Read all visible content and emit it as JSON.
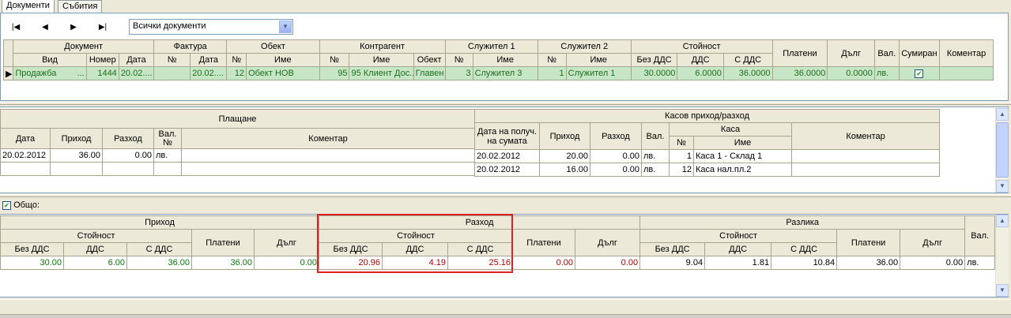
{
  "tabs": [
    "Документи",
    "Събития"
  ],
  "nav": {
    "first": "|◀",
    "prev": "◀",
    "next": "▶",
    "last": "▶|"
  },
  "filter": {
    "selected": "Всички документи"
  },
  "docs": {
    "groups": {
      "document": "Документ",
      "invoice": "Фактура",
      "object": "Обект",
      "partner": "Контрагент",
      "emp1": "Служител 1",
      "emp2": "Служител 2",
      "value": "Стойност"
    },
    "cols": {
      "type": "Вид",
      "number": "Номер",
      "date": "Дата",
      "inv_no": "№",
      "inv_date": "Дата",
      "obj_no": "№",
      "obj_name": "Име",
      "partner_no": "№",
      "partner_name": "Име",
      "partner_obj": "Обект",
      "emp1_no": "№",
      "emp1_name": "Име",
      "emp2_no": "№",
      "emp2_name": "Име",
      "no_vat": "Без ДДС",
      "vat": "ДДС",
      "with_vat": "С ДДС",
      "paid": "Платени",
      "debt": "Дълг",
      "cur": "Вал.",
      "summed": "Сумиран",
      "comment": "Коментар"
    },
    "row": {
      "type": "Продажба",
      "dots": "...",
      "number": "1444",
      "date": "20.02....",
      "inv_date": "20.02....",
      "obj_no": "12",
      "obj_name": "Обект НОВ",
      "partner_no": "95",
      "partner_name": "95 Клиент Дос...",
      "partner_obj": "Главен",
      "emp1_no": "3",
      "emp1_name": "Служител 3",
      "emp2_no": "1",
      "emp2_name": "Служител 1",
      "no_vat": "30.0000",
      "vat": "6.0000",
      "with_vat": "36.0000",
      "paid": "36.0000",
      "debt": "0.0000",
      "cur": "лв."
    }
  },
  "payments": {
    "title": "Плащане",
    "cols": {
      "date": "Дата",
      "income": "Приход",
      "expense": "Разход",
      "cur": "Вал. №",
      "comment": "Коментар"
    },
    "rows": [
      {
        "date": "20.02.2012",
        "income": "36.00",
        "expense": "0.00",
        "cur": "лв."
      }
    ]
  },
  "cash": {
    "title": "Касов приход/разход",
    "cols": {
      "recv_date": "Дата на получ. на сумата",
      "income": "Приход",
      "expense": "Разход",
      "cur": "Вал.",
      "cashbox": "Каса",
      "no": "№",
      "name": "Име",
      "comment": "Коментар"
    },
    "rows": [
      {
        "date": "20.02.2012",
        "income": "20.00",
        "expense": "0.00",
        "cur": "лв.",
        "no": "1",
        "name": "Каса 1 - Склад 1"
      },
      {
        "date": "20.02.2012",
        "income": "16.00",
        "expense": "0.00",
        "cur": "лв.",
        "no": "12",
        "name": "Каса нал.пл.2"
      }
    ]
  },
  "totals": {
    "label": "Общо:",
    "income": "Приход",
    "expense": "Разход",
    "diff": "Разлика",
    "value": "Стойност",
    "no_vat": "Без ДДС",
    "vat": "ДДС",
    "with_vat": "С ДДС",
    "paid": "Платени",
    "debt": "Дълг",
    "cur": "Вал.",
    "row": {
      "in_no_vat": "30.00",
      "in_vat": "6.00",
      "in_with_vat": "36.00",
      "in_paid": "36.00",
      "in_debt": "0.00",
      "ex_no_vat": "20.96",
      "ex_vat": "4.19",
      "ex_with_vat": "25.16",
      "ex_paid": "0.00",
      "ex_debt": "0.00",
      "df_no_vat": "9.04",
      "df_vat": "1.81",
      "df_with_vat": "10.84",
      "df_paid": "36.00",
      "df_debt": "0.00",
      "cur": "лв."
    }
  }
}
